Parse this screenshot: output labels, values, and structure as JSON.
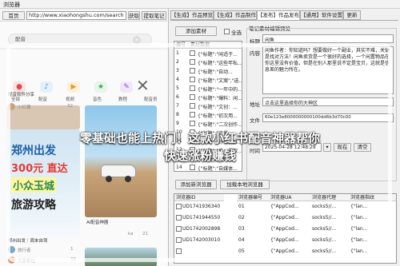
{
  "window": {
    "title": "浏览器"
  },
  "browser": {
    "home_label": "首页",
    "url": "http://www.xiaohongshu.com/search",
    "go_label": "获取",
    "fetch_label": "提取笔记"
  },
  "webpage": {
    "search_value": "配音",
    "categories": [
      "全部",
      "配音",
      "视频",
      "音色",
      "教程",
      "配音员"
    ],
    "cards": [
      {
        "title": "配音软件分享",
        "author": "小红薯",
        "likes": "32"
      },
      {
        "title": "郑州出发｜周末自驾",
        "author": "旅行者",
        "likes": "1"
      },
      {
        "title": "AI配音神器",
        "author": "大家都在",
        "likes": "38"
      },
      {
        "title": "山水风光",
        "author": "ka",
        "likes": "21"
      }
    ],
    "poster": {
      "line1": "郑州出发",
      "line2": "300元 直达",
      "line3": "小众玉城",
      "line4": "旅游攻略"
    }
  },
  "tabs": [
    "【生成】作品预览",
    "【生成】作品制作",
    "【发布】作品发布",
    "【通用】软件设置",
    "更新"
  ],
  "left_grid": {
    "add_label": "添加素材",
    "check_label": "全选",
    "headers": [
      "编号",
      "素材数据"
    ],
    "rows": [
      {
        "num": "1",
        "text": "{\"标题\":\"闲适于..."
      },
      {
        "num": "2",
        "text": "{\"标题\":\"这些年私..."
      },
      {
        "num": "3",
        "text": "{\"标题\":\"自动..."
      },
      {
        "num": "4",
        "text": "{\"标题\":\"文案\",\"选..."
      },
      {
        "num": "5",
        "text": "{\"标题\":\"一年中的..."
      },
      {
        "num": "6",
        "text": "{\"标题\":\"爆料：闲..."
      },
      {
        "num": "7",
        "text": "{\"标题\":\"文创：..."
      },
      {
        "num": "8",
        "text": "{\"标题\":\"初次用..."
      },
      {
        "num": "9",
        "text": "{\"标题\":\"二次创作..."
      },
      {
        "num": "10",
        "text": "{\"标题\":\"流量..."
      },
      {
        "num": "11",
        "text": "{\"标题\":\"好物，推..."
      },
      {
        "num": "12",
        "text": "{\"标题\":\"绝：爆款..."
      },
      {
        "num": "13",
        "text": "{\"标题\":\"(博)..."
      },
      {
        "num": "14",
        "text": "{\"标题\":\"自媒体..."
      }
    ]
  },
  "editor": {
    "group_title": "笔记素材编辑预览",
    "title_label": "标题",
    "title_value": "闲鱼",
    "content_label": "内容",
    "content_value": "闲鱼作者：你知道吗？想要做好一个副业，其实不难，关键是找对方法！闲鱼卖货是一个很好的选择，一个闲置物品在你这里没有价值，但是在别人那里说不定是宝贝，这就是信息差的魅力所在。",
    "address_label": "地址",
    "address_value": "点击这里选择你的大神区",
    "file_label": "文件",
    "file_value": "60e123e8000000000100dd6b3d70c00",
    "time_label": "时间",
    "time_value": "2025-04-28 12:48:29",
    "now_label": "现在",
    "clear_label": "清空"
  },
  "buttons": {
    "add_browser": "添加新浏览器",
    "add_local": "加载本地浏览器"
  },
  "browser_grid": {
    "headers": [
      "浏览器ID",
      "浏览器编号",
      "浏览器UA",
      "浏览器代理",
      "浏览器指纹"
    ],
    "rows": [
      {
        "id": "UD1741936340",
        "num": "01",
        "ua": "{\"AppCod...",
        "proxy": "socks5//...",
        "fp": "{\"lan..."
      },
      {
        "id": "UD1741944550",
        "num": "02",
        "ua": "{\"AppCod...",
        "proxy": "socks5//...",
        "fp": "{\"lan..."
      },
      {
        "id": "UD1742002898",
        "num": "03",
        "ua": "{\"AppCod...",
        "proxy": "socks5//...",
        "fp": "{\"lan..."
      },
      {
        "id": "UD1742003010",
        "num": "04",
        "ua": "{\"AppCod...",
        "proxy": "socks5//...",
        "fp": "{\"lan..."
      },
      {
        "id": "",
        "num": "05",
        "ua": "{\"AppCod...",
        "proxy": "socks5//...",
        "fp": "{\"lan..."
      }
    ]
  },
  "overlay": {
    "line1": "零基础也能上热门！这款小红书配音神器帮你",
    "line2": "快速涨粉赚钱"
  }
}
